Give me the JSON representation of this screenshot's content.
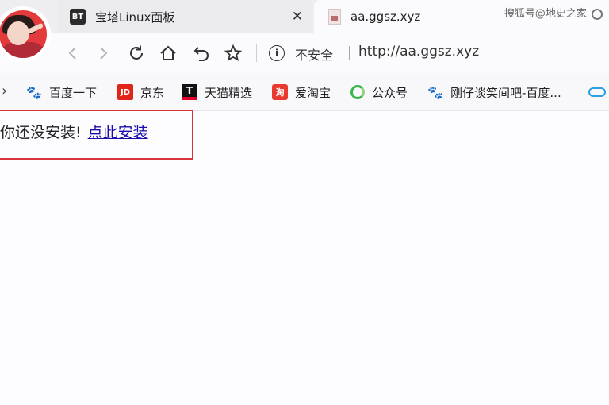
{
  "tabs": [
    {
      "icon_text": "BT",
      "title": "宝塔Linux面板",
      "close": "✕"
    },
    {
      "title": "aa.ggsz.xyz"
    }
  ],
  "watermark": "搜狐号@地史之家",
  "navbar": {
    "insecure_label": "不安全",
    "separator": "|",
    "url": "http://aa.ggsz.xyz",
    "info_glyph": "i"
  },
  "bookmarks": {
    "chevron": "›",
    "items": [
      {
        "label": "百度一下",
        "icon": "baidu-icon",
        "glyph": "🐾"
      },
      {
        "label": "京东",
        "icon": "jd-icon",
        "glyph": "JD"
      },
      {
        "label": "天猫精选",
        "icon": "tmall-icon",
        "glyph": "T"
      },
      {
        "label": "爱淘宝",
        "icon": "taobao-icon",
        "glyph": "淘"
      },
      {
        "label": "公众号",
        "icon": "wechat-icon",
        "glyph": ""
      },
      {
        "label": "刚仔谈笑间吧-百度...",
        "icon": "baidu-icon",
        "glyph": "🐾"
      },
      {
        "label": "",
        "icon": "cloud-icon",
        "glyph": ""
      }
    ]
  },
  "content": {
    "message": "你还没安装!",
    "link_text": "点此安装"
  },
  "colors": {
    "highlight_border": "#d7353a",
    "link": "#1a0dab"
  }
}
